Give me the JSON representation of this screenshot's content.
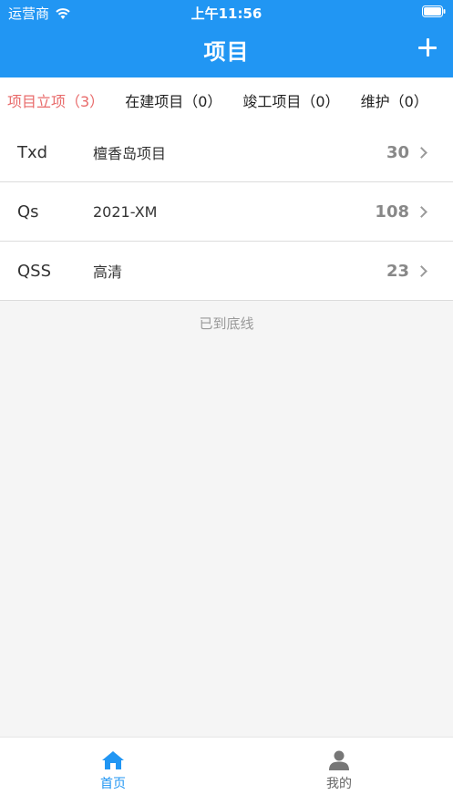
{
  "status_bar": {
    "carrier": "运营商",
    "time": "上午11:56"
  },
  "nav": {
    "title": "项目",
    "add_icon": "plus-icon"
  },
  "tabs": [
    {
      "label": "项目立项（3）",
      "active": true
    },
    {
      "label": "在建项目（0）",
      "active": false
    },
    {
      "label": "竣工项目（0）",
      "active": false
    },
    {
      "label": "维护（0）",
      "active": false
    }
  ],
  "rows": [
    {
      "code": "Txd",
      "name": "檀香岛项目",
      "count": "30"
    },
    {
      "code": "Qs",
      "name": "2021-XM",
      "count": "108"
    },
    {
      "code": "QSS",
      "name": "高清",
      "count": "23"
    }
  ],
  "list_end_text": "已到底线",
  "tabbar": {
    "home_label": "首页",
    "mine_label": "我的"
  },
  "colors": {
    "primary": "#2196f3",
    "active_tab": "#e86a6a",
    "count_gray": "#888888"
  }
}
